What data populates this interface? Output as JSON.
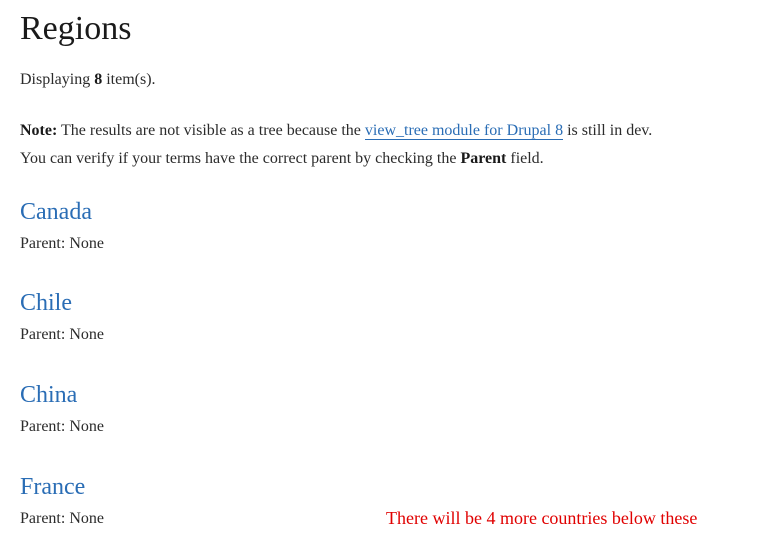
{
  "page": {
    "title": "Regions"
  },
  "summary": {
    "prefix": "Displaying ",
    "count": "8",
    "suffix": " item(s)."
  },
  "note": {
    "label": "Note:",
    "text_before_link": " The results are not visible as a tree because the ",
    "link_text": "view_tree module for Drupal 8",
    "text_after_link": " is still in dev.",
    "line2_before": "You can verify if your terms have the correct parent by checking the ",
    "line2_bold": "Parent",
    "line2_after": " field."
  },
  "regions": [
    {
      "name": "Canada",
      "parent": "Parent: None"
    },
    {
      "name": "Chile",
      "parent": "Parent: None"
    },
    {
      "name": "China",
      "parent": "Parent: None"
    },
    {
      "name": "France",
      "parent": "Parent: None"
    }
  ],
  "annotation": {
    "text": "There will be 4 more countries below these"
  },
  "colors": {
    "link": "#2a6db5",
    "text": "#2b2b2b",
    "annotation": "#e00000"
  }
}
